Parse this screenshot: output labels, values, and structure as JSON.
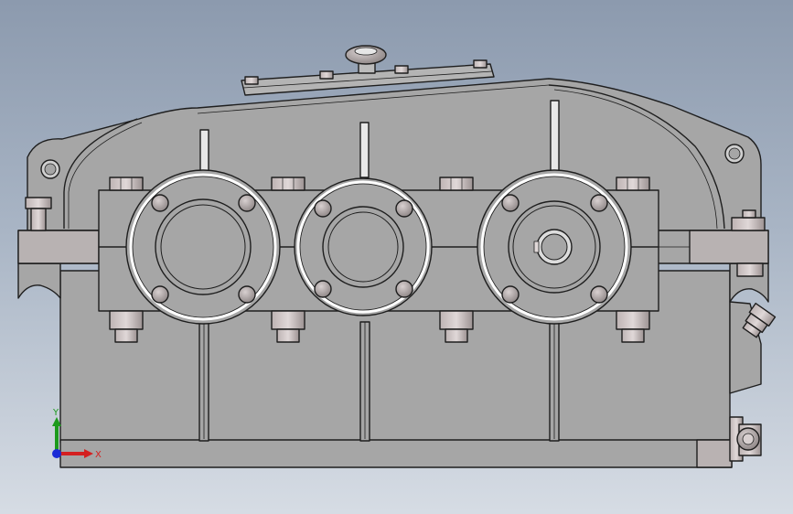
{
  "viewport": {
    "model": "gearbox-reducer-front-view",
    "background_top": "#8c9aae",
    "background_bottom": "#d6dce4",
    "body_color": "#a6a6a6",
    "edge_color": "#1e1e1e"
  },
  "triad": {
    "x_label": "X",
    "y_label": "Y",
    "x_color": "#d42020",
    "y_color": "#1c9a1c",
    "z_color": "#1a2ad6"
  }
}
